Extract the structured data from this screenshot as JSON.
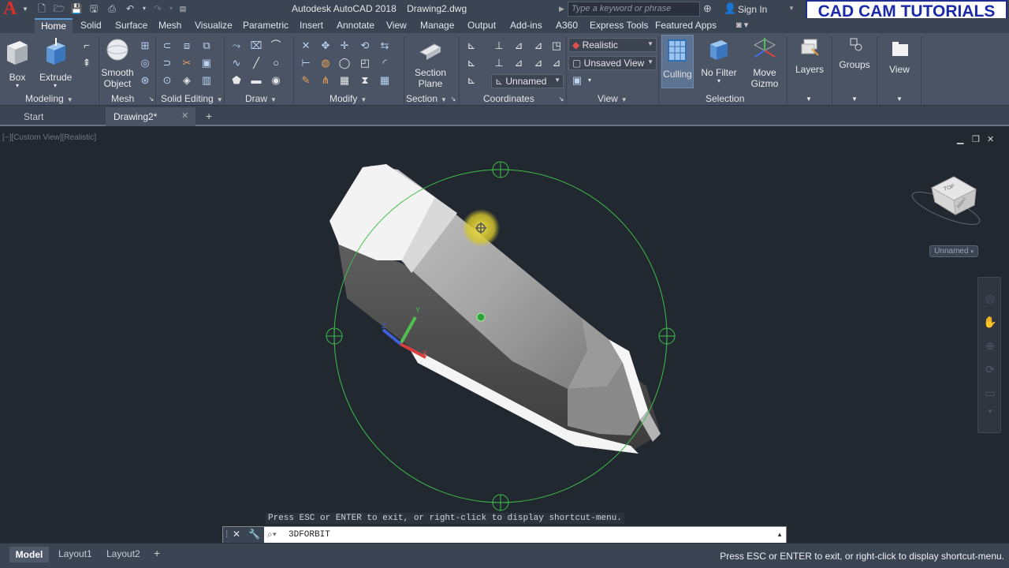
{
  "titlebar": {
    "app_title": "Autodesk AutoCAD 2018",
    "file_name": "Drawing2.dwg",
    "search_placeholder": "Type a keyword or phrase",
    "sign_in": "Sign In",
    "brand_banner": "CAD CAM TUTORIALS",
    "logo_letter": "A"
  },
  "ribbon_tabs": [
    "Home",
    "Solid",
    "Surface",
    "Mesh",
    "Visualize",
    "Parametric",
    "Insert",
    "Annotate",
    "View",
    "Manage",
    "Output",
    "Add-ins",
    "A360",
    "Express Tools",
    "Featured Apps"
  ],
  "ribbon": {
    "modeling": {
      "title": "Modeling",
      "box": "Box",
      "extrude": "Extrude"
    },
    "mesh": {
      "title": "Mesh",
      "smooth_object_1": "Smooth",
      "smooth_object_2": "Object"
    },
    "solid_editing": {
      "title": "Solid Editing"
    },
    "draw": {
      "title": "Draw"
    },
    "modify": {
      "title": "Modify"
    },
    "section": {
      "title": "Section",
      "section_plane_1": "Section",
      "section_plane_2": "Plane"
    },
    "coordinates": {
      "title": "Coordinates",
      "ucs_dropdown": "Unnamed"
    },
    "view": {
      "title": "View",
      "visual_style": "Realistic",
      "saved_view": "Unsaved View"
    },
    "selection": {
      "title": "Selection",
      "culling": "Culling",
      "no_filter": "No Filter",
      "move_gizmo_1": "Move",
      "move_gizmo_2": "Gizmo"
    },
    "layers": "Layers",
    "groups": "Groups",
    "view_panel": "View"
  },
  "file_tabs": {
    "start": "Start",
    "drawing": "Drawing2*"
  },
  "viewport": {
    "label": "[−][Custom View][Realistic]",
    "wcs_label": "Unnamed",
    "viewcube_top": "TOP",
    "viewcube_right": "RIGHT"
  },
  "command": {
    "hint": "Press ESC or ENTER to exit, or right-click to display shortcut-menu.",
    "current": "3DFORBIT"
  },
  "layouts": {
    "model": "Model",
    "layout1": "Layout1",
    "layout2": "Layout2"
  },
  "status_message": "Press ESC or ENTER to exit, or right-click to display shortcut-menu."
}
